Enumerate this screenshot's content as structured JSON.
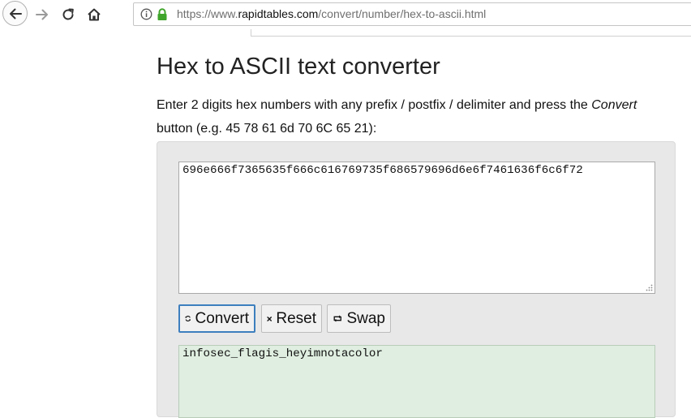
{
  "browser": {
    "url_scheme": "https://www.",
    "url_host": "rapidtables.com",
    "url_path": "/convert/number/hex-to-ascii.html",
    "dropdown_hint": "• • • •"
  },
  "page": {
    "title": "Hex to ASCII text converter",
    "description_before": "Enter 2 digits hex numbers with any prefix / postfix / delimiter and press the ",
    "description_emph": "Convert",
    "description_after": " button (e.g. 45 78 61 6d 70 6C 65 21):"
  },
  "converter": {
    "hex_input_value": "696e666f7365635f666c616769735f686579696d6e6f7461636f6c6f72",
    "buttons": {
      "convert_label": "Convert",
      "reset_label": "Reset",
      "swap_label": "Swap"
    },
    "ascii_output_value": "infosec_flagis_heyimnotacolor"
  },
  "icons": {
    "back": "arrow-left-icon",
    "forward": "arrow-right-icon",
    "reload": "reload-icon",
    "home": "home-icon",
    "info": "info-circle-icon",
    "lock": "lock-icon",
    "convert": "refresh-icon",
    "reset": "x-icon",
    "swap": "swap-icon"
  },
  "colors": {
    "lock_green": "#3fa52b",
    "convert_focus_border": "#3d7fbe",
    "output_background": "#dfeee0",
    "panel_background": "#e8e8e8"
  }
}
